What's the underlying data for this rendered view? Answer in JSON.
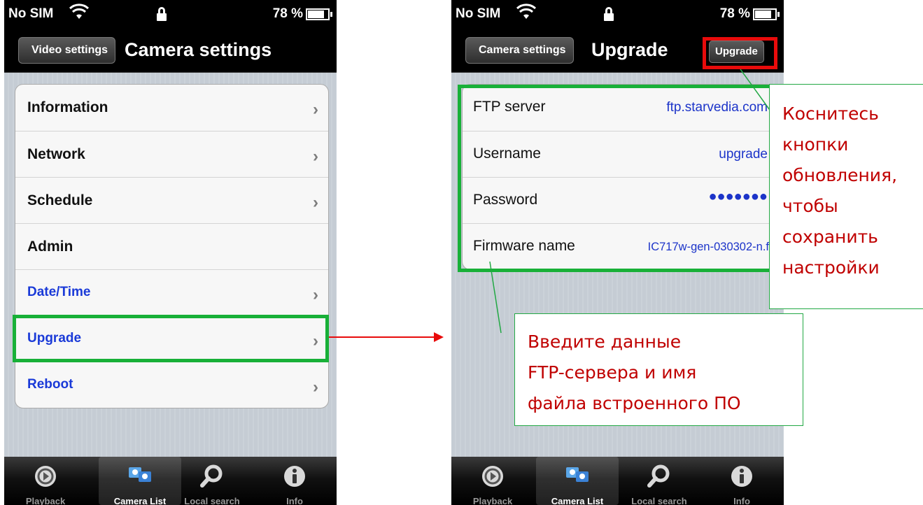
{
  "status_bar": {
    "carrier": "No SIM",
    "battery": "78 %"
  },
  "left_screen": {
    "back_button": "Video settings",
    "title": "Camera settings",
    "items": [
      {
        "label": "Information",
        "sub": false,
        "chevron": true
      },
      {
        "label": "Network",
        "sub": false,
        "chevron": true
      },
      {
        "label": "Schedule",
        "sub": false,
        "chevron": true
      },
      {
        "label": "Admin",
        "sub": false,
        "chevron": false
      },
      {
        "label": "Date/Time",
        "sub": true,
        "chevron": true
      },
      {
        "label": "Upgrade",
        "sub": true,
        "chevron": true
      },
      {
        "label": "Reboot",
        "sub": true,
        "chevron": true
      }
    ]
  },
  "right_screen": {
    "back_button": "Camera settings",
    "title": "Upgrade",
    "action_button": "Upgrade",
    "fields": [
      {
        "label": "FTP server",
        "value": "ftp.starvedia.com"
      },
      {
        "label": "Username",
        "value": "upgrade"
      },
      {
        "label": "Password",
        "value": "●●●●●●●"
      },
      {
        "label": "Firmware name",
        "value": "IC717w-gen-030302-n.f"
      }
    ]
  },
  "tabs": [
    {
      "label": "Playback",
      "icon": "playback-icon"
    },
    {
      "label": "Camera List",
      "icon": "camera-list-icon"
    },
    {
      "label": "Local search",
      "icon": "search-icon"
    },
    {
      "label": "Info",
      "icon": "info-icon"
    }
  ],
  "annotations": {
    "upgrade_button_note": [
      "Коснитесь",
      "кнопки",
      "обновления,",
      "чтобы",
      "сохранить",
      "настройки"
    ],
    "ftp_note": [
      "Введите данные",
      "FTP-сервера и имя",
      "файла встроенного ПО"
    ]
  },
  "colors": {
    "highlight_green": "#18b038",
    "highlight_red": "#e80b0b",
    "annotation_text": "#c00000",
    "link_blue": "#1a3ad8"
  }
}
